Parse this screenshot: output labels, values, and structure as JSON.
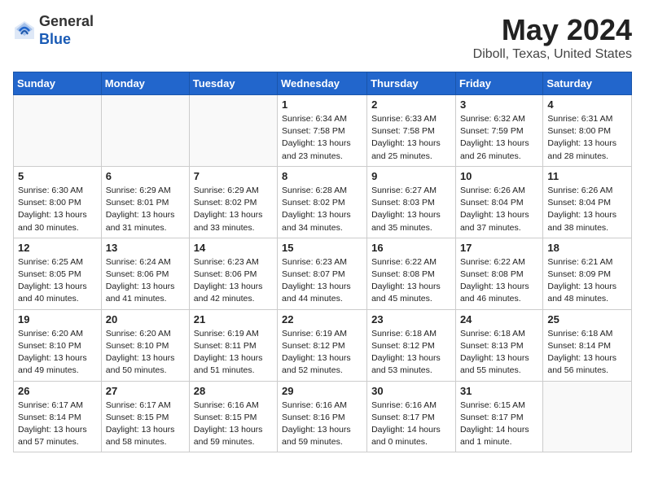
{
  "logo": {
    "line1": "General",
    "line2": "Blue"
  },
  "title": "May 2024",
  "location": "Diboll, Texas, United States",
  "weekdays": [
    "Sunday",
    "Monday",
    "Tuesday",
    "Wednesday",
    "Thursday",
    "Friday",
    "Saturday"
  ],
  "weeks": [
    [
      {
        "day": "",
        "info": ""
      },
      {
        "day": "",
        "info": ""
      },
      {
        "day": "",
        "info": ""
      },
      {
        "day": "1",
        "info": "Sunrise: 6:34 AM\nSunset: 7:58 PM\nDaylight: 13 hours\nand 23 minutes."
      },
      {
        "day": "2",
        "info": "Sunrise: 6:33 AM\nSunset: 7:58 PM\nDaylight: 13 hours\nand 25 minutes."
      },
      {
        "day": "3",
        "info": "Sunrise: 6:32 AM\nSunset: 7:59 PM\nDaylight: 13 hours\nand 26 minutes."
      },
      {
        "day": "4",
        "info": "Sunrise: 6:31 AM\nSunset: 8:00 PM\nDaylight: 13 hours\nand 28 minutes."
      }
    ],
    [
      {
        "day": "5",
        "info": "Sunrise: 6:30 AM\nSunset: 8:00 PM\nDaylight: 13 hours\nand 30 minutes."
      },
      {
        "day": "6",
        "info": "Sunrise: 6:29 AM\nSunset: 8:01 PM\nDaylight: 13 hours\nand 31 minutes."
      },
      {
        "day": "7",
        "info": "Sunrise: 6:29 AM\nSunset: 8:02 PM\nDaylight: 13 hours\nand 33 minutes."
      },
      {
        "day": "8",
        "info": "Sunrise: 6:28 AM\nSunset: 8:02 PM\nDaylight: 13 hours\nand 34 minutes."
      },
      {
        "day": "9",
        "info": "Sunrise: 6:27 AM\nSunset: 8:03 PM\nDaylight: 13 hours\nand 35 minutes."
      },
      {
        "day": "10",
        "info": "Sunrise: 6:26 AM\nSunset: 8:04 PM\nDaylight: 13 hours\nand 37 minutes."
      },
      {
        "day": "11",
        "info": "Sunrise: 6:26 AM\nSunset: 8:04 PM\nDaylight: 13 hours\nand 38 minutes."
      }
    ],
    [
      {
        "day": "12",
        "info": "Sunrise: 6:25 AM\nSunset: 8:05 PM\nDaylight: 13 hours\nand 40 minutes."
      },
      {
        "day": "13",
        "info": "Sunrise: 6:24 AM\nSunset: 8:06 PM\nDaylight: 13 hours\nand 41 minutes."
      },
      {
        "day": "14",
        "info": "Sunrise: 6:23 AM\nSunset: 8:06 PM\nDaylight: 13 hours\nand 42 minutes."
      },
      {
        "day": "15",
        "info": "Sunrise: 6:23 AM\nSunset: 8:07 PM\nDaylight: 13 hours\nand 44 minutes."
      },
      {
        "day": "16",
        "info": "Sunrise: 6:22 AM\nSunset: 8:08 PM\nDaylight: 13 hours\nand 45 minutes."
      },
      {
        "day": "17",
        "info": "Sunrise: 6:22 AM\nSunset: 8:08 PM\nDaylight: 13 hours\nand 46 minutes."
      },
      {
        "day": "18",
        "info": "Sunrise: 6:21 AM\nSunset: 8:09 PM\nDaylight: 13 hours\nand 48 minutes."
      }
    ],
    [
      {
        "day": "19",
        "info": "Sunrise: 6:20 AM\nSunset: 8:10 PM\nDaylight: 13 hours\nand 49 minutes."
      },
      {
        "day": "20",
        "info": "Sunrise: 6:20 AM\nSunset: 8:10 PM\nDaylight: 13 hours\nand 50 minutes."
      },
      {
        "day": "21",
        "info": "Sunrise: 6:19 AM\nSunset: 8:11 PM\nDaylight: 13 hours\nand 51 minutes."
      },
      {
        "day": "22",
        "info": "Sunrise: 6:19 AM\nSunset: 8:12 PM\nDaylight: 13 hours\nand 52 minutes."
      },
      {
        "day": "23",
        "info": "Sunrise: 6:18 AM\nSunset: 8:12 PM\nDaylight: 13 hours\nand 53 minutes."
      },
      {
        "day": "24",
        "info": "Sunrise: 6:18 AM\nSunset: 8:13 PM\nDaylight: 13 hours\nand 55 minutes."
      },
      {
        "day": "25",
        "info": "Sunrise: 6:18 AM\nSunset: 8:14 PM\nDaylight: 13 hours\nand 56 minutes."
      }
    ],
    [
      {
        "day": "26",
        "info": "Sunrise: 6:17 AM\nSunset: 8:14 PM\nDaylight: 13 hours\nand 57 minutes."
      },
      {
        "day": "27",
        "info": "Sunrise: 6:17 AM\nSunset: 8:15 PM\nDaylight: 13 hours\nand 58 minutes."
      },
      {
        "day": "28",
        "info": "Sunrise: 6:16 AM\nSunset: 8:15 PM\nDaylight: 13 hours\nand 59 minutes."
      },
      {
        "day": "29",
        "info": "Sunrise: 6:16 AM\nSunset: 8:16 PM\nDaylight: 13 hours\nand 59 minutes."
      },
      {
        "day": "30",
        "info": "Sunrise: 6:16 AM\nSunset: 8:17 PM\nDaylight: 14 hours\nand 0 minutes."
      },
      {
        "day": "31",
        "info": "Sunrise: 6:15 AM\nSunset: 8:17 PM\nDaylight: 14 hours\nand 1 minute."
      },
      {
        "day": "",
        "info": ""
      }
    ]
  ]
}
